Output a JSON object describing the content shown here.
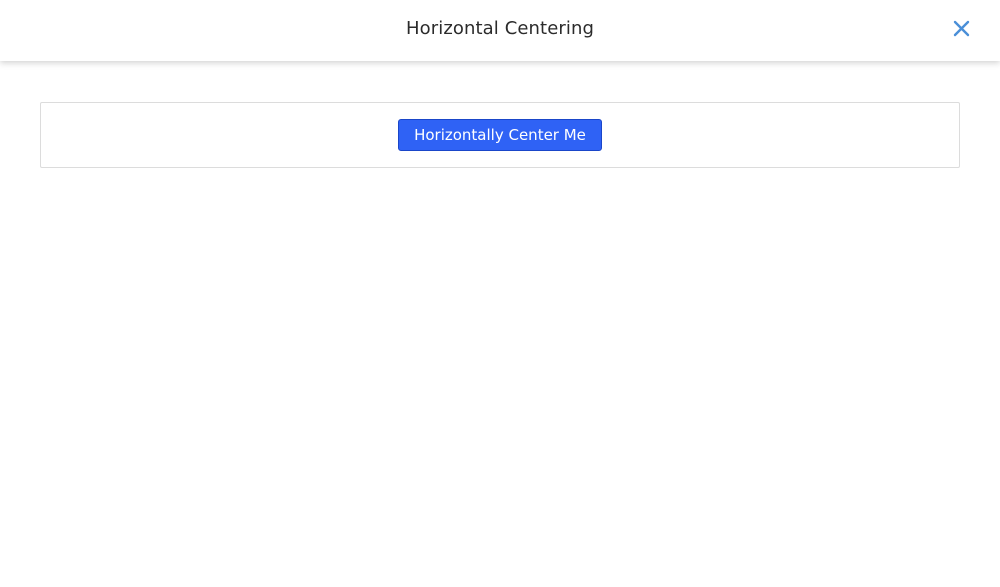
{
  "header": {
    "title": "Horizontal Centering",
    "close_icon": "close-icon",
    "close_color": "#4a8fd8"
  },
  "main": {
    "button_label": "Horizontally Center Me",
    "button_color": "#2f62f5"
  }
}
